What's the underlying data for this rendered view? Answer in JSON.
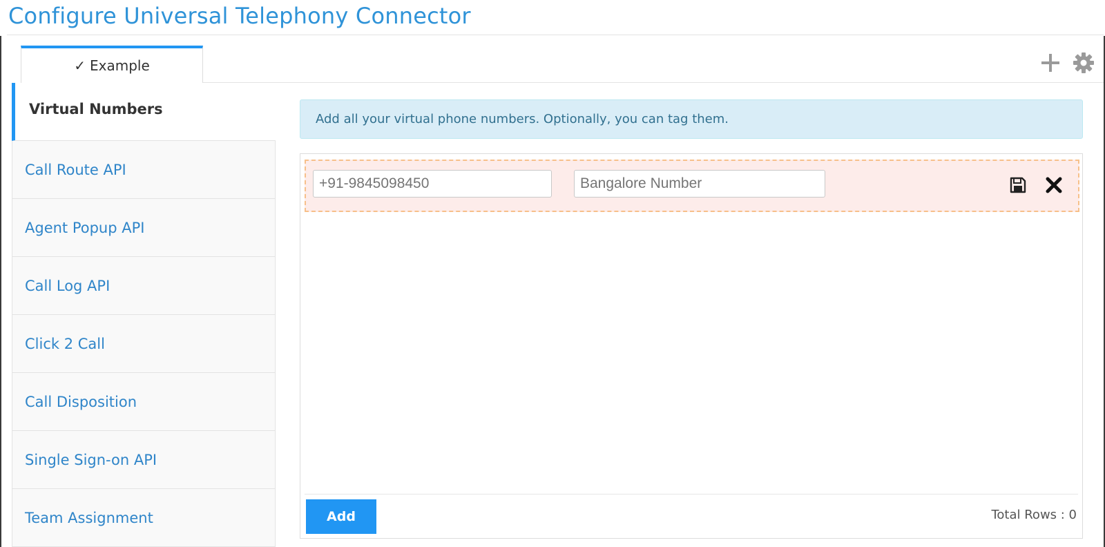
{
  "page": {
    "title": "Configure Universal Telephony Connector"
  },
  "tabs": [
    {
      "check": "✓",
      "label": "Example",
      "active": true
    }
  ],
  "toolbar": {
    "add_icon": "plus-icon",
    "settings_icon": "gear-icon"
  },
  "sidebar": {
    "items": [
      {
        "label": "Virtual Numbers",
        "active": true
      },
      {
        "label": "Call Route API"
      },
      {
        "label": "Agent Popup API"
      },
      {
        "label": "Call Log API"
      },
      {
        "label": "Click 2 Call"
      },
      {
        "label": "Call Disposition"
      },
      {
        "label": "Single Sign-on API"
      },
      {
        "label": "Team Assignment"
      }
    ]
  },
  "main": {
    "info": "Add all your virtual phone numbers. Optionally, you can tag them.",
    "edit_row": {
      "number_placeholder": "+91-9845098450",
      "tag_placeholder": "Bangalore Number",
      "save_icon": "save-icon",
      "delete_icon": "close-icon"
    },
    "footer": {
      "add_label": "Add",
      "total_rows": "Total Rows : 0"
    }
  },
  "colors": {
    "accent": "#2196f3",
    "title": "#2f93d8",
    "info_bg": "#d9edf7",
    "edit_row_bg": "#fdecea"
  }
}
